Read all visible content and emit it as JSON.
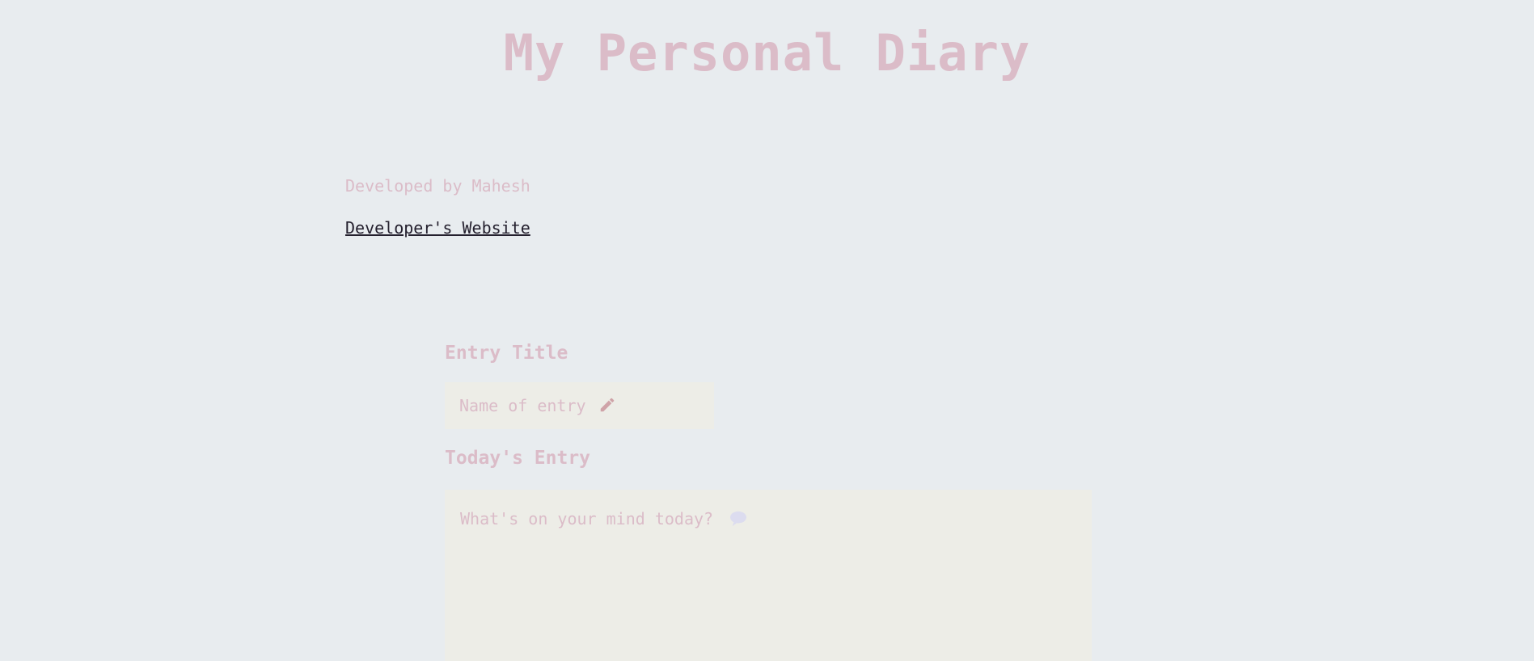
{
  "header": {
    "title": "My Personal Diary"
  },
  "credits": {
    "developed_by": "Developed by Mahesh",
    "website_link_label": "Developer's Website"
  },
  "form": {
    "title_label": "Entry Title",
    "title_placeholder": "Name of entry",
    "title_icon": "pencil-icon",
    "entry_label": "Today's Entry",
    "entry_placeholder": "What's on your mind today?",
    "entry_icon": "speech-bubble-icon"
  },
  "colors": {
    "background": "#e8ecef",
    "accent_pink": "#dbbcc8",
    "input_background": "#edede7",
    "link": "#24202e",
    "pencil_icon": "#cfa3a8",
    "speech_icon": "#dcdcef"
  }
}
